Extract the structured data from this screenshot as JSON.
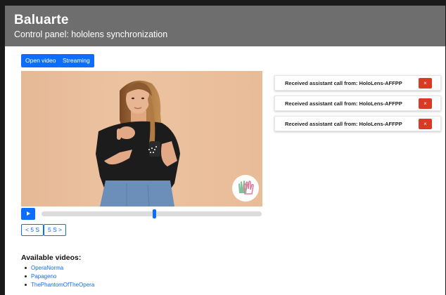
{
  "header": {
    "title": "Baluarte",
    "subtitle": "Control panel: hololens synchronization"
  },
  "toolbar": {
    "open_video_label": "Open video",
    "streaming_label": "Streaming"
  },
  "player": {
    "progress_fraction": 0.51,
    "skip_back_label": "< 5 S",
    "skip_forward_label": "5 S >",
    "play_icon": "play-icon"
  },
  "notifications": [
    {
      "text": "Received assistant call from: HoloLens-AFFPP",
      "close_label": "×"
    },
    {
      "text": "Received assistant call from: HoloLens-AFFPP",
      "close_label": "×"
    },
    {
      "text": "Received assistant call from: HoloLens-AFFPP",
      "close_label": "×"
    }
  ],
  "videos": {
    "heading": "Available videos:",
    "items": [
      "OperaNorma",
      "Papageno",
      "ThePhantomOfTheOpera"
    ]
  },
  "colors": {
    "header_bg": "#6e6e6e",
    "primary": "#0d6efd",
    "danger": "#d83a24"
  }
}
